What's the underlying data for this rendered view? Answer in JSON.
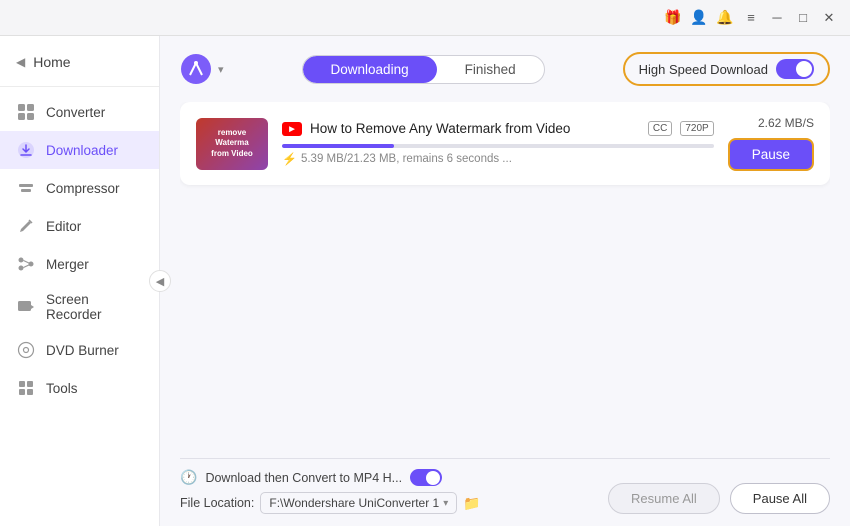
{
  "titlebar": {
    "icons": [
      "gift-icon",
      "user-icon",
      "bell-icon",
      "menu-icon",
      "minimize-icon",
      "maximize-icon",
      "close-icon"
    ]
  },
  "sidebar": {
    "home_label": "Home",
    "items": [
      {
        "id": "converter",
        "label": "Converter",
        "icon": "⚙️"
      },
      {
        "id": "downloader",
        "label": "Downloader",
        "icon": "⬇️",
        "active": true
      },
      {
        "id": "compressor",
        "label": "Compressor",
        "icon": "🗜️"
      },
      {
        "id": "editor",
        "label": "Editor",
        "icon": "✂️"
      },
      {
        "id": "merger",
        "label": "Merger",
        "icon": "🔗"
      },
      {
        "id": "screen-recorder",
        "label": "Screen Recorder",
        "icon": "📹"
      },
      {
        "id": "dvd-burner",
        "label": "DVD Burner",
        "icon": "💿"
      },
      {
        "id": "tools",
        "label": "Tools",
        "icon": "🛠️"
      }
    ]
  },
  "topbar": {
    "downloading_tab": "Downloading",
    "finished_tab": "Finished",
    "high_speed_label": "High Speed Download"
  },
  "download_item": {
    "title": "How to Remove Any Watermark from Video",
    "cc_badge": "CC",
    "res_badge": "720P",
    "progress_percent": 26,
    "progress_text": "⚡ 5.39 MB/21.23 MB, remains 6 seconds ...",
    "speed": "2.62 MB/S",
    "pause_btn_label": "Pause",
    "thumbnail_text": "remove\nWaterma\nfrom Video"
  },
  "bottom": {
    "convert_label": "Download then Convert to MP4 H...",
    "file_location_label": "File Location:",
    "file_path": "F:\\Wondershare UniConverter 1",
    "resume_all_label": "Resume All",
    "pause_all_label": "Pause All"
  }
}
